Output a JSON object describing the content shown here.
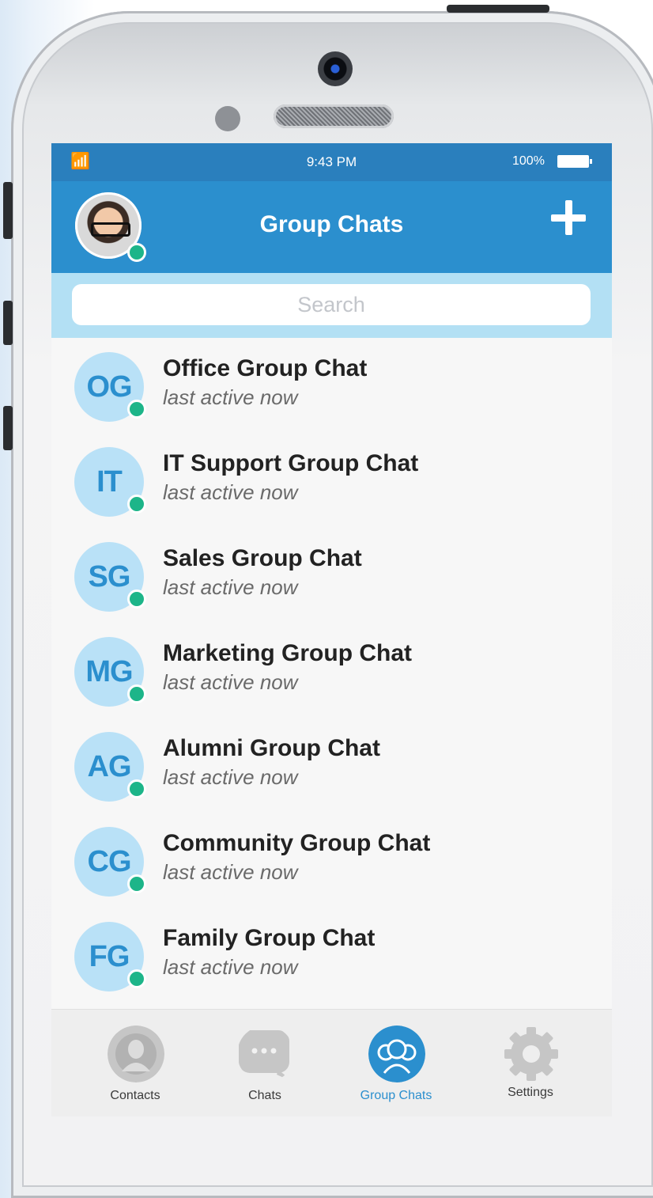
{
  "status_bar": {
    "time": "9:43 PM",
    "battery": "100%"
  },
  "header": {
    "title": "Group Chats"
  },
  "search": {
    "placeholder": "Search"
  },
  "chats": [
    {
      "initials": "OG",
      "name": "Office Group Chat",
      "status": "last active now"
    },
    {
      "initials": "IT",
      "name": "IT Support Group Chat",
      "status": "last active now"
    },
    {
      "initials": "SG",
      "name": "Sales Group Chat",
      "status": "last active now"
    },
    {
      "initials": "MG",
      "name": "Marketing Group Chat",
      "status": "last active now"
    },
    {
      "initials": "AG",
      "name": "Alumni Group Chat",
      "status": "last active now"
    },
    {
      "initials": "CG",
      "name": "Community Group Chat",
      "status": "last active now"
    },
    {
      "initials": "FG",
      "name": "Family Group Chat",
      "status": "last active now"
    }
  ],
  "tabs": [
    {
      "label": "Contacts",
      "icon": "contacts-icon"
    },
    {
      "label": "Chats",
      "icon": "chat-bubble-icon"
    },
    {
      "label": "Group Chats",
      "icon": "group-icon",
      "active": true
    },
    {
      "label": "Settings",
      "icon": "gear-icon"
    }
  ],
  "colors": {
    "accent": "#2b8fce",
    "online": "#1db589",
    "search_bg": "#b3e0f4",
    "avatar_bg": "#b9e1f7"
  }
}
